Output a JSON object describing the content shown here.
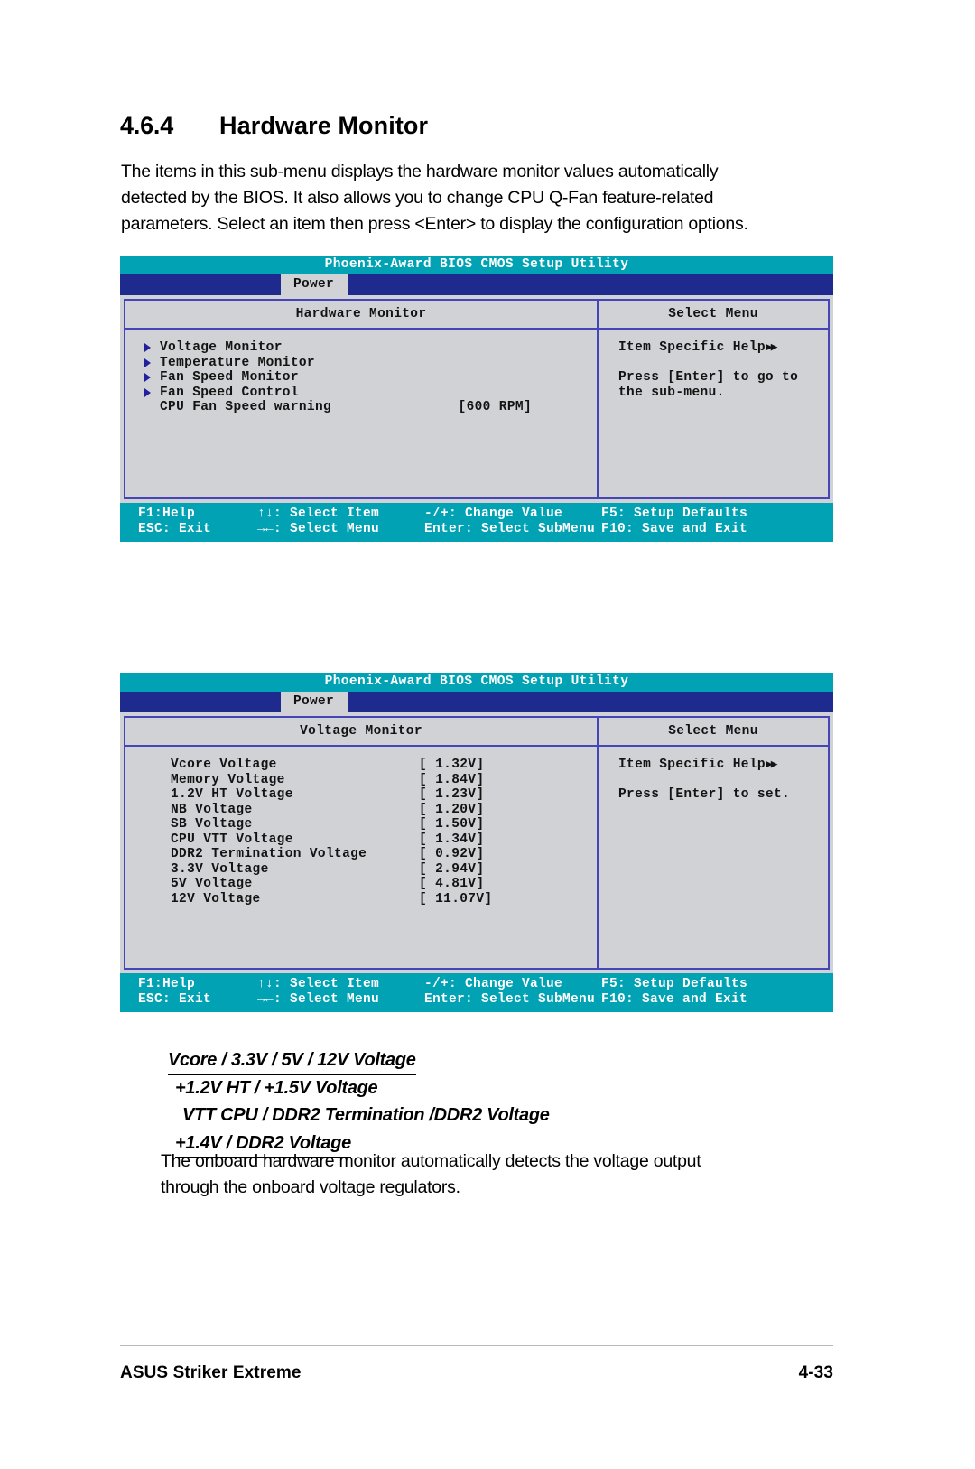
{
  "section": {
    "number": "4.6.4",
    "title": "Hardware Monitor"
  },
  "intro_paragraph": {
    "line1": "The items in this sub-menu displays the hardware monitor values automatically",
    "line2": "detected by the BIOS. It also allows you to change CPU Q-Fan feature-related",
    "line3": "parameters. Select an item then press <Enter> to display the configuration options."
  },
  "bios_screen_1": {
    "title": "Phoenix-Award BIOS CMOS Setup Utility",
    "tab": "Power",
    "left_panel_header": "Hardware Monitor",
    "right_panel_header": "Select Menu",
    "menu_items": [
      {
        "label": "Voltage Monitor",
        "submenu": true,
        "value": ""
      },
      {
        "label": "Temperature Monitor",
        "submenu": true,
        "value": ""
      },
      {
        "label": "Fan Speed Monitor",
        "submenu": true,
        "value": ""
      },
      {
        "label": "Fan Speed Control",
        "submenu": true,
        "value": ""
      },
      {
        "label": "CPU Fan Speed warning",
        "submenu": false,
        "value": "[600 RPM]"
      }
    ],
    "help": {
      "title": "Item Specific Help",
      "line1": "Press [Enter] to go to",
      "line2": "the sub-menu."
    },
    "keys": {
      "row1": {
        "k1": "F1:Help",
        "k2": "↑↓: Select Item",
        "k3": "-/+: Change Value",
        "k4": "F5: Setup Defaults"
      },
      "row2": {
        "k1": "ESC: Exit",
        "k2": "→←: Select Menu",
        "k3": "Enter: Select SubMenu",
        "k4": "F10: Save and Exit"
      }
    }
  },
  "bios_screen_2": {
    "title": "Phoenix-Award BIOS CMOS Setup Utility",
    "tab": "Power",
    "left_panel_header": "Voltage Monitor",
    "right_panel_header": "Select Menu",
    "voltages": [
      {
        "label": "Vcore Voltage",
        "value": "[ 1.32V]"
      },
      {
        "label": "Memory Voltage",
        "value": "[ 1.84V]"
      },
      {
        "label": "1.2V HT Voltage",
        "value": "[ 1.23V]"
      },
      {
        "label": "NB Voltage",
        "value": "[ 1.20V]"
      },
      {
        "label": "SB Voltage",
        "value": "[ 1.50V]"
      },
      {
        "label": "CPU VTT Voltage",
        "value": "[ 1.34V]"
      },
      {
        "label": "DDR2 Termination Voltage",
        "value": "[ 0.92V]"
      },
      {
        "label": "3.3V Voltage",
        "value": "[ 2.94V]"
      },
      {
        "label": "5V Voltage",
        "value": "[ 4.81V]"
      },
      {
        "label": "12V Voltage",
        "value": "[ 11.07V]"
      }
    ],
    "help": {
      "title": "Item Specific Help",
      "line1": "Press [Enter] to set.",
      "line2": ""
    },
    "keys": {
      "row1": {
        "k1": "F1:Help",
        "k2": "↑↓: Select Item",
        "k3": "-/+: Change Value",
        "k4": "F5: Setup Defaults"
      },
      "row2": {
        "k1": "ESC: Exit",
        "k2": "→←: Select Menu",
        "k3": "Enter: Select SubMenu",
        "k4": "F10: Save and Exit"
      }
    }
  },
  "subheads": {
    "line1": "Vcore / 3.3V / 5V / 12V Voltage",
    "line2": "+1.2V HT / +1.5V Voltage",
    "line3": "VTT CPU / DDR2 Termination /DDR2 Voltage",
    "line4": "+1.4V / DDR2 Voltage "
  },
  "closing_paragraph": {
    "line1": "The onboard hardware monitor automatically detects the voltage output",
    "line2": "through the onboard voltage regulators."
  },
  "page_footer": {
    "left": "ASUS Striker Extreme",
    "right": "4-33"
  },
  "colors": {
    "titlebar_teal": "#00a2b3",
    "menubar_navy": "#1f2a8f",
    "panel_gray": "#d0d2d5",
    "border_blue": "#4545b8",
    "arrow_blue": "#21219c"
  }
}
